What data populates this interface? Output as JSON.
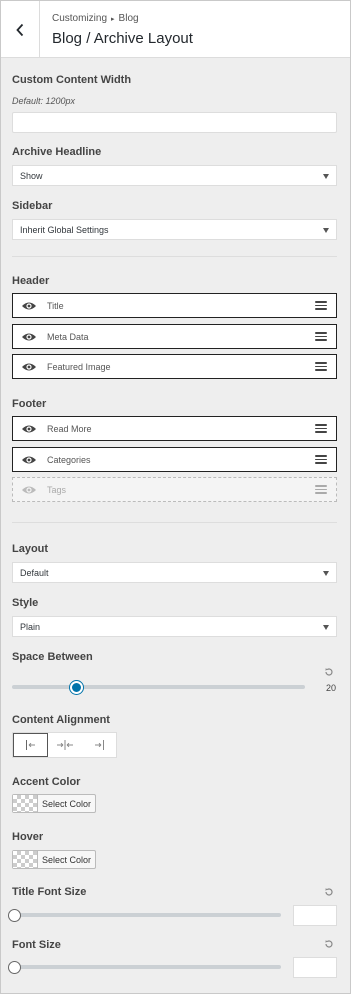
{
  "header": {
    "breadcrumb_parent": "Customizing",
    "breadcrumb_current": "Blog",
    "title": "Blog / Archive Layout"
  },
  "content_width": {
    "label": "Custom Content Width",
    "description": "Default: 1200px",
    "value": ""
  },
  "archive_headline": {
    "label": "Archive Headline",
    "value": "Show"
  },
  "sidebar": {
    "label": "Sidebar",
    "value": "Inherit Global Settings"
  },
  "header_section": {
    "label": "Header",
    "items": [
      {
        "label": "Title",
        "visible": true
      },
      {
        "label": "Meta Data",
        "visible": true
      },
      {
        "label": "Featured Image",
        "visible": true
      }
    ]
  },
  "footer_section": {
    "label": "Footer",
    "items": [
      {
        "label": "Read More",
        "visible": true
      },
      {
        "label": "Categories",
        "visible": true
      },
      {
        "label": "Tags",
        "visible": false
      }
    ]
  },
  "layout": {
    "label": "Layout",
    "value": "Default"
  },
  "style": {
    "label": "Style",
    "value": "Plain"
  },
  "space_between": {
    "label": "Space Between",
    "value": "20",
    "fraction": 0.22
  },
  "content_alignment": {
    "label": "Content Alignment",
    "active": "left"
  },
  "accent_color": {
    "label": "Accent Color",
    "button": "Select Color"
  },
  "hover_color": {
    "label": "Hover",
    "button": "Select Color"
  },
  "title_font_size": {
    "label": "Title Font Size",
    "value": ""
  },
  "font_size": {
    "label": "Font Size",
    "value": ""
  },
  "colors": {
    "accent": "#0073aa",
    "background": "#eeeeee"
  }
}
